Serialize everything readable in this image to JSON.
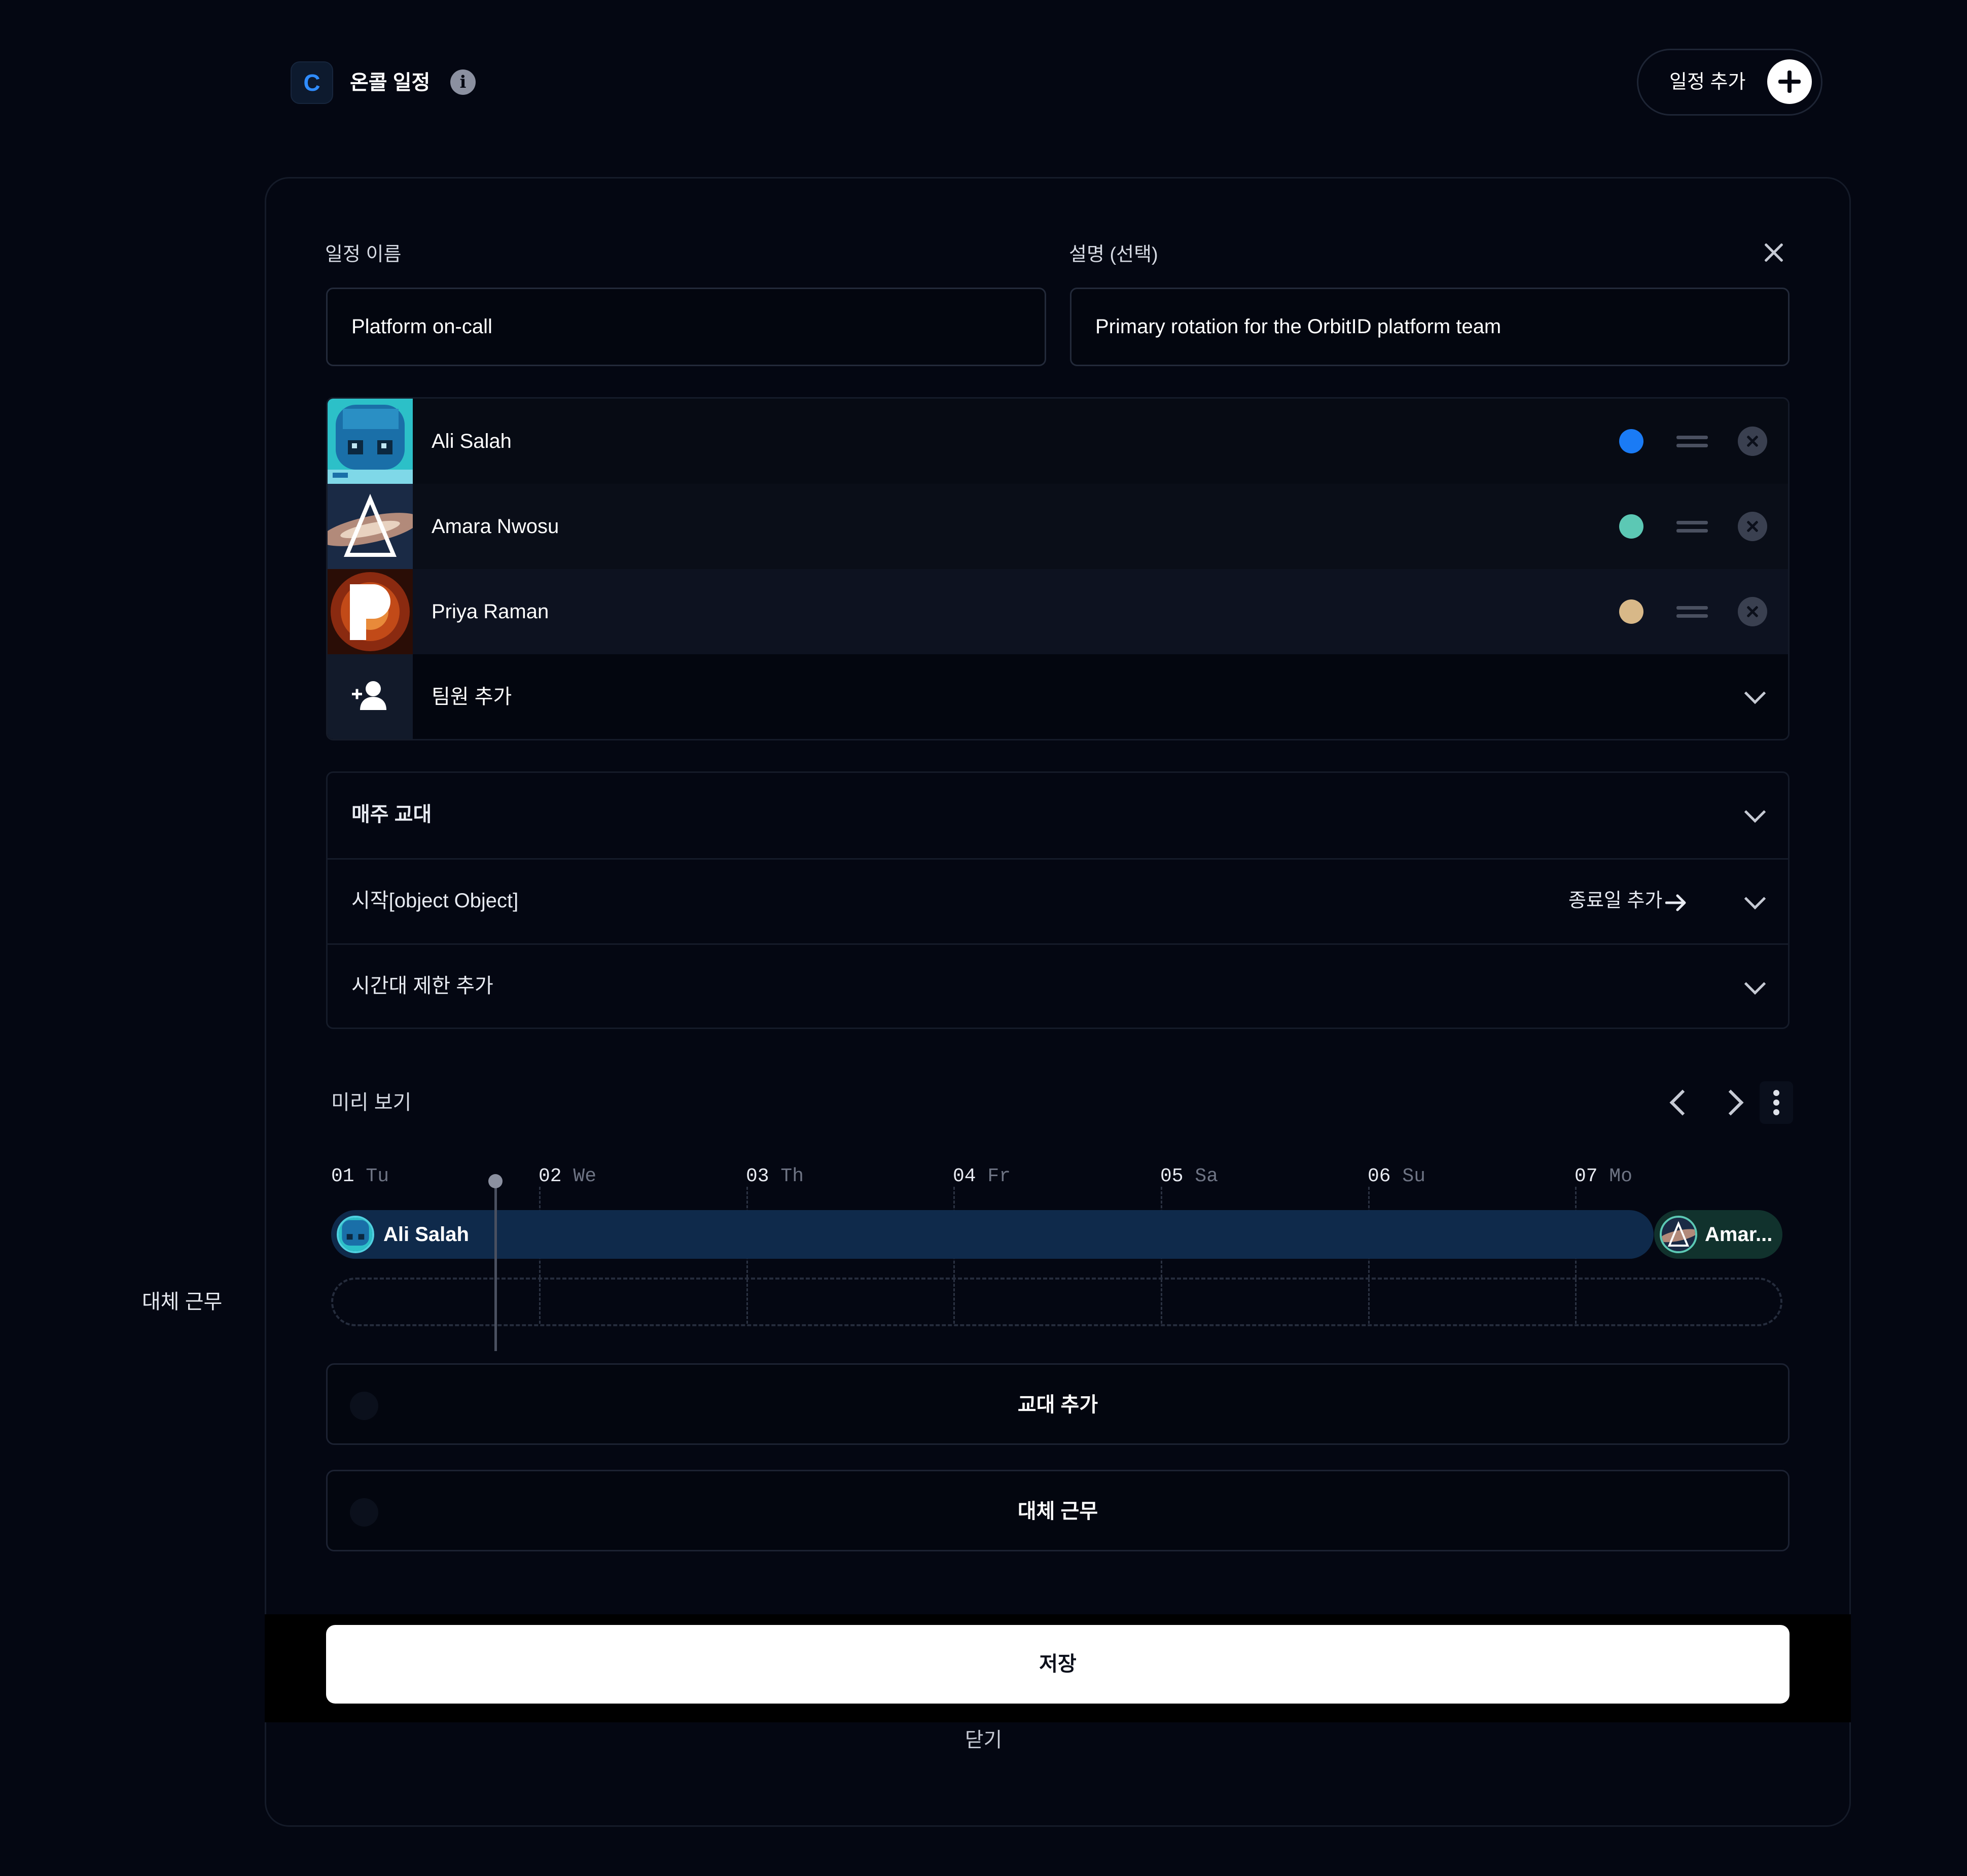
{
  "header": {
    "logo_letter": "C",
    "title": "온콜 일정",
    "info_icon": "info-icon",
    "add_schedule_label": "일정 추가",
    "add_icon": "plus-icon"
  },
  "form": {
    "name_label": "일정 이름",
    "name_value": "Platform on-call",
    "description_label": "설명 (선택)",
    "description_value": "Primary rotation for the OrbitID platform team",
    "close_icon": "close-icon"
  },
  "members": [
    {
      "name": "Ali Salah",
      "color": "#1a7bf5"
    },
    {
      "name": "Amara Nwosu",
      "color": "#5cc8b4"
    },
    {
      "name": "Priya Raman",
      "color": "#d8b888"
    }
  ],
  "add_member_label": "팀원 추가",
  "options": {
    "rotation_label": "매주 교대",
    "start_label": "시작[object Object]",
    "add_end_date_label": "종료일 추가",
    "time_restriction_label": "시간대 제한 추가"
  },
  "preview": {
    "title": "미리 보기",
    "days": [
      {
        "num": "01",
        "dow": "Tu"
      },
      {
        "num": "02",
        "dow": "We"
      },
      {
        "num": "03",
        "dow": "Th"
      },
      {
        "num": "04",
        "dow": "Fr"
      },
      {
        "num": "05",
        "dow": "Sa"
      },
      {
        "num": "06",
        "dow": "Su"
      },
      {
        "num": "07",
        "dow": "Mo"
      }
    ],
    "current_shift": "Ali Salah",
    "next_shift": "Amar...",
    "override_side_label": "대체 근무"
  },
  "actions": {
    "add_rotation_label": "교대 추가",
    "override_label": "대체 근무"
  },
  "footer": {
    "save_label": "저장",
    "close_label": "닫기"
  },
  "colors": {
    "background": "#040712",
    "accent": "#2f8cff",
    "shift_bar": "#0f2a4b",
    "next_shift_bar": "#11322d"
  }
}
